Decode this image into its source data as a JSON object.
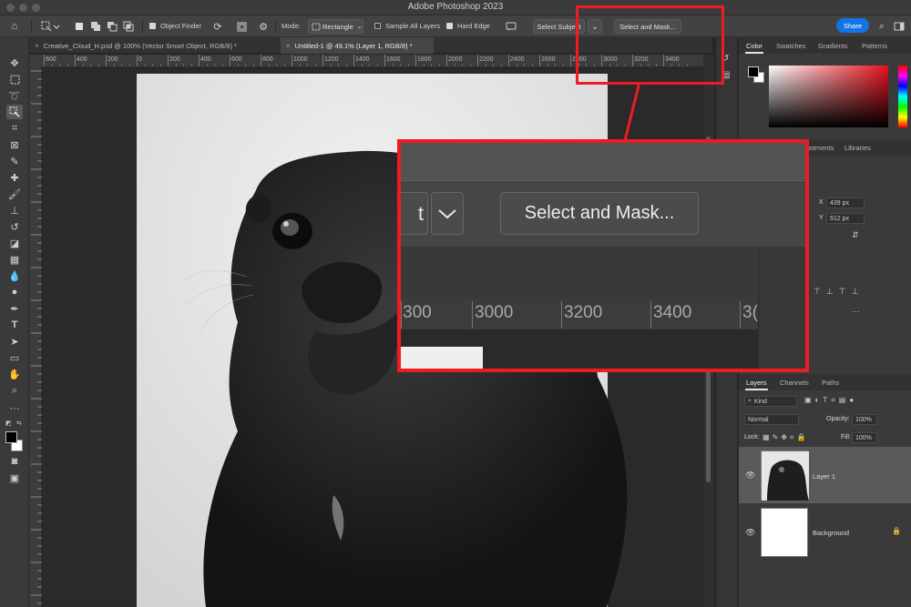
{
  "window": {
    "title": "Adobe Photoshop 2023"
  },
  "options_bar": {
    "object_finder_label": "Object Finder",
    "mode_label": "Mode:",
    "mode_value": "Rectangle",
    "sample_all_layers_label": "Sample All Layers",
    "hard_edge_label": "Hard Edge",
    "select_subject_label": "Select Subject",
    "select_and_mask_label": "Select and Mask...",
    "share_label": "Share",
    "object_finder_checked": true,
    "sample_all_layers_checked": false,
    "hard_edge_checked": true
  },
  "doc_tabs": [
    {
      "label": "Creative_Cloud_H.psd @ 100% (Vector Smart Object, RGB/8) *",
      "active": false
    },
    {
      "label": "Untitled-1 @ 49.1% (Layer 1, RGB/8) *",
      "active": true
    }
  ],
  "ruler": {
    "h_labels": [
      "600",
      "400",
      "200",
      "0",
      "200",
      "400",
      "600",
      "800",
      "1000",
      "1200",
      "1400",
      "1600",
      "1800",
      "2000",
      "2200",
      "2400",
      "2600",
      "2800",
      "3000",
      "3200",
      "3400"
    ]
  },
  "panels": {
    "color_tabs": [
      "Color",
      "Swatches",
      "Gradients",
      "Patterns"
    ],
    "properties_tabs": [
      "Adjustments",
      "Libraries"
    ],
    "properties": {
      "x_label": "X",
      "x_value": "439 px",
      "y_label": "Y",
      "y_value": "512 px"
    },
    "layers_tabs": [
      "Layers",
      "Channels",
      "Paths"
    ],
    "layers_filter_label": "Kind",
    "blend_mode": "Normal",
    "opacity_label": "Opacity:",
    "opacity_value": "100%",
    "lock_label": "Lock:",
    "fill_label": "Fill:",
    "fill_value": "100%",
    "layers": [
      {
        "name": "Layer 1",
        "selected": true
      },
      {
        "name": "Background",
        "selected": false
      }
    ]
  },
  "zoom_callout": {
    "select_and_mask_label": "Select and Mask...",
    "partial_button_text": "t",
    "ruler_labels": [
      "300",
      "3000",
      "3200",
      "3400",
      "3("
    ]
  },
  "colors": {
    "accent_blue": "#1473e6",
    "callout_red": "#ed1c24",
    "foreground": "#000000",
    "background": "#ffffff"
  }
}
